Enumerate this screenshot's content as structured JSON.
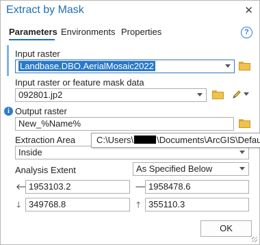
{
  "window": {
    "title": "Extract by Mask"
  },
  "tabs": [
    {
      "label": "Parameters"
    },
    {
      "label": "Environments"
    },
    {
      "label": "Properties"
    }
  ],
  "help": {
    "glyph": "?"
  },
  "input_raster": {
    "label": "Input raster",
    "value": "Landbase.DBO.AerialMosaic2022"
  },
  "mask": {
    "label": "Input raster or feature mask data",
    "value": "092801.jp2"
  },
  "output_raster": {
    "label": "Output raster",
    "value": "New_%Name%"
  },
  "tooltip": {
    "prefix": "C:\\Users\\",
    "suffix": "\\Documents\\ArcGIS\\Default.g"
  },
  "extraction_area": {
    "label": "Extraction Area",
    "value": "Inside"
  },
  "analysis_extent": {
    "label": "Analysis Extent",
    "value": "As Specified Below",
    "left": "1953103.2",
    "right": "1958478.6",
    "bottom": "349768.8",
    "top": "355110.3"
  },
  "ok_button": {
    "label": "OK"
  },
  "colors": {
    "accent": "#1f6fb4",
    "selection": "#2b78c6",
    "folder": "#f0c24c"
  }
}
